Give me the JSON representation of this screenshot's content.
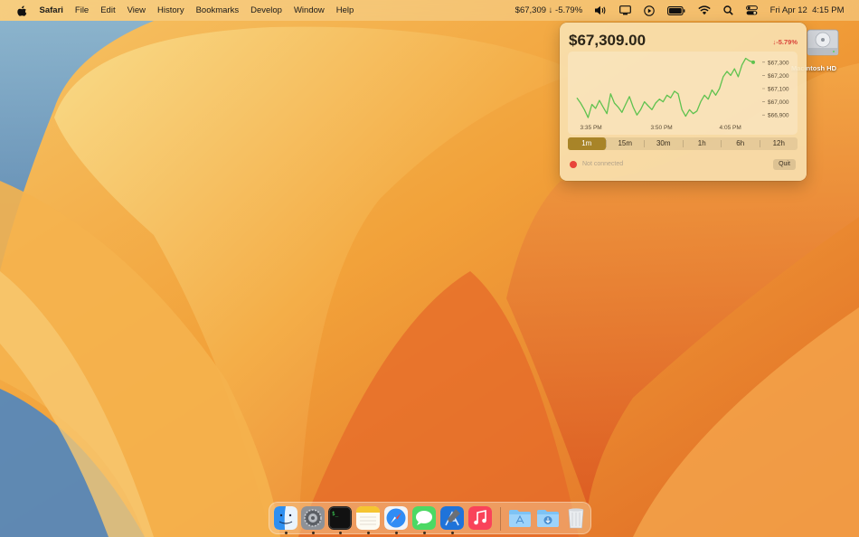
{
  "menubar": {
    "apple_icon": "apple-logo-icon",
    "app_name": "Safari",
    "menus": [
      "File",
      "Edit",
      "View",
      "History",
      "Bookmarks",
      "Develop",
      "Window",
      "Help"
    ],
    "ticker": "$67,309 ↓ -5.79%",
    "status_icons": [
      "volume-icon",
      "screen-mirroring-icon",
      "now-playing-icon",
      "battery-icon",
      "wifi-icon",
      "spotlight-search-icon",
      "control-center-icon"
    ],
    "clock": "Fri Apr 12  4:15 PM"
  },
  "popover": {
    "price": "$67,309.00",
    "change": "↓-5.79%",
    "change_color": "#d9443a",
    "timeframes": [
      "1m",
      "15m",
      "30m",
      "1h",
      "6h",
      "12h"
    ],
    "active_timeframe": "1m",
    "status": "Not connected",
    "status_color": "#e8443a",
    "quit_label": "Quit"
  },
  "chart_data": {
    "type": "line",
    "x_ticks": [
      "3:35 PM",
      "3:50 PM",
      "4:05 PM"
    ],
    "y_ticks": [
      "$67,300",
      "$67,200",
      "$67,100",
      "$67,000",
      "$66,900"
    ],
    "ylim": [
      66860,
      67340
    ],
    "line_color": "#5fc24f",
    "values": [
      67030,
      66990,
      66940,
      66880,
      66980,
      66950,
      67010,
      66960,
      66910,
      67060,
      66990,
      66960,
      66920,
      66980,
      67040,
      66960,
      66900,
      66940,
      67000,
      66970,
      66940,
      66990,
      67020,
      67000,
      67050,
      67030,
      67080,
      67060,
      66940,
      66890,
      66940,
      66910,
      66930,
      67000,
      67050,
      67020,
      67090,
      67050,
      67100,
      67190,
      67230,
      67200,
      67250,
      67190,
      67280,
      67330,
      67310,
      67300
    ]
  },
  "desktop": {
    "drive_label": "Macintosh HD",
    "drive_icon": "hard-drive-icon"
  },
  "dock": {
    "apps": [
      {
        "name": "finder-icon",
        "running": true
      },
      {
        "name": "system-settings-icon",
        "running": true
      },
      {
        "name": "terminal-icon",
        "running": true
      },
      {
        "name": "notes-icon",
        "running": true
      },
      {
        "name": "safari-icon",
        "running": true
      },
      {
        "name": "messages-icon",
        "running": true
      },
      {
        "name": "xcode-icon",
        "running": true
      },
      {
        "name": "music-icon",
        "running": false
      }
    ],
    "stacks": [
      "applications-folder-icon",
      "downloads-folder-icon",
      "trash-icon"
    ]
  }
}
